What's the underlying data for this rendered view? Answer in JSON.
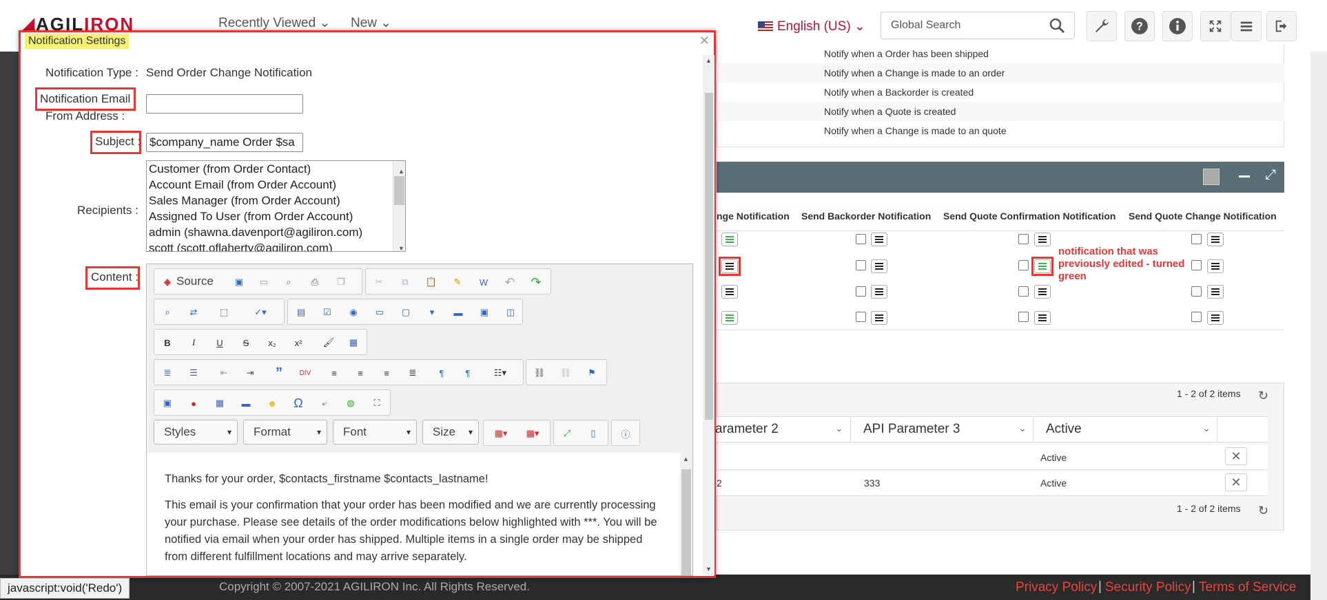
{
  "topbar": {
    "logo_prefix": "AGIL",
    "logo_suffix": "IRON",
    "nav": [
      "Recently Viewed ⌄",
      "New ⌄"
    ],
    "language": "English (US)",
    "search_placeholder": "Global Search"
  },
  "notifications_list": [
    "Notify when a Order has been shipped",
    "Notify when a Change is made to an order",
    "Notify when a Backorder is created",
    "Notify when a Quote is created",
    "Notify when a Change is made to an quote"
  ],
  "matrix": {
    "columns": [
      "nge Notification",
      "Send Backorder Notification",
      "Send Quote Confirmation Notification",
      "Send Quote Change Notification"
    ],
    "annotation": "notification that was previously edited - turned green"
  },
  "grid": {
    "pager": "1 - 2 of 2 items",
    "headers": [
      "arameter 2",
      "API Parameter 3",
      "Active"
    ],
    "rows": [
      {
        "p2": "",
        "p3": "",
        "active": "Active"
      },
      {
        "p2": "2",
        "p3": "333",
        "active": "Active"
      }
    ]
  },
  "footer": {
    "copyright": "Copyright © 2007-2021 AGILIRON Inc. All Rights Reserved.",
    "links": [
      "Privacy Policy",
      "Security Policy",
      "Terms of Service"
    ],
    "status": "javascript:void('Redo')"
  },
  "modal": {
    "title": "Notification Settings",
    "notification_type_label": "Notification Type :",
    "notification_type_value": "Send Order Change Notification",
    "email_label_1": "Notification Email",
    "email_label_2": "From Address :",
    "email_value": "",
    "subject_label": "Subject :",
    "subject_value": "$company_name Order $sa",
    "recipients_label": "Recipients :",
    "recipients": [
      "Customer (from Order Contact)",
      "Account Email (from Order Account)",
      "Sales Manager (from Order Account)",
      "Assigned To User (from Order Account)",
      "admin (shawna.davenport@agiliron.com)",
      "scott (scott.oflaherty@agiliron.com)"
    ],
    "content_label": "Content :",
    "editor": {
      "source_label": "Source",
      "dropdowns": [
        "Styles",
        "Format",
        "Font",
        "Size"
      ],
      "body_line1": "Thanks for your order, $contacts_firstname $contacts_lastname!",
      "body_para": [
        "This email is your confirmation that your order has been modified and we are currently processing",
        "your purchase. Please see details of the order modifications below highlighted with ***. You will be",
        "notified via email when your order has shipped. Multiple items in a single order may be shipped",
        "from different fulfillment locations and may arrive separately."
      ]
    }
  }
}
